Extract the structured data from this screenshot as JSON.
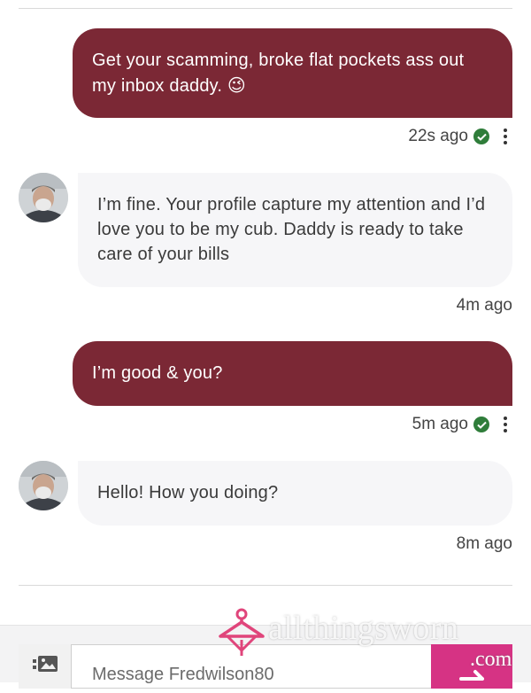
{
  "messages": [
    {
      "direction": "out",
      "text": "Get your scamming, broke flat pockets ass out my inbox daddy. 😉",
      "time": "22s ago",
      "read": true
    },
    {
      "direction": "in",
      "text": "I’m fine. Your profile capture my attention and I’d love you to be my cub. Daddy is ready to take care of your bills",
      "time": "4m ago"
    },
    {
      "direction": "out",
      "text": "I’m good & you?",
      "time": "5m ago",
      "read": true
    },
    {
      "direction": "in",
      "text": "Hello! How you doing?",
      "time": "8m ago"
    }
  ],
  "composer": {
    "placeholder": "Message Fredwilson80",
    "image_icon": "image-upload-icon",
    "send_icon": "send-arrow-icon"
  },
  "watermark": {
    "brand": "allthingsworn",
    "tld": ".com"
  },
  "colors": {
    "outgoing_bubble": "#7b2835",
    "incoming_bubble": "#f6f6f8",
    "read_check": "#2f7d3a",
    "send_button": "#d63384"
  }
}
